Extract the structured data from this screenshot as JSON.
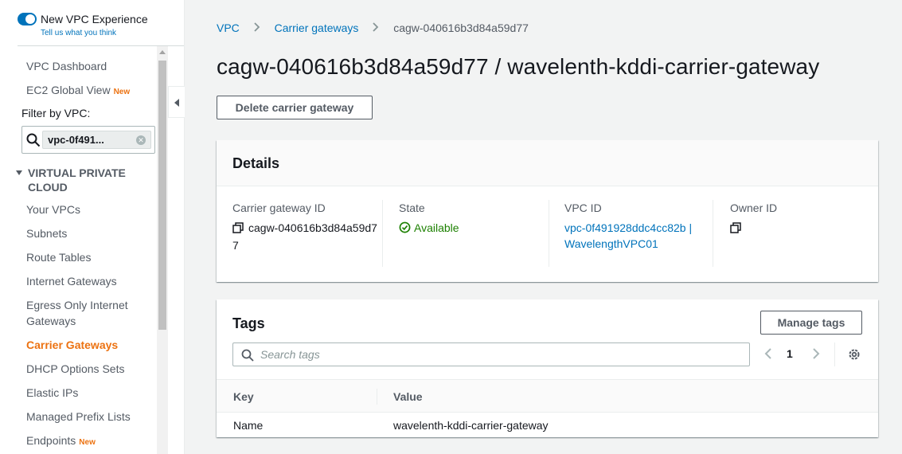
{
  "sidebar": {
    "toggle": {
      "title": "New VPC Experience",
      "subtitle": "Tell us what you think",
      "enabled": true
    },
    "top_items": [
      {
        "label": "VPC Dashboard",
        "badge": ""
      },
      {
        "label": "EC2 Global View",
        "badge": "New"
      }
    ],
    "filter": {
      "label": "Filter by VPC:",
      "value": "vpc-0f491..."
    },
    "section": {
      "title": "VIRTUAL PRIVATE CLOUD"
    },
    "items": [
      {
        "label": "Your VPCs",
        "badge": ""
      },
      {
        "label": "Subnets",
        "badge": ""
      },
      {
        "label": "Route Tables",
        "badge": ""
      },
      {
        "label": "Internet Gateways",
        "badge": ""
      },
      {
        "label": "Egress Only Internet Gateways",
        "badge": ""
      },
      {
        "label": "Carrier Gateways",
        "badge": "",
        "active": true
      },
      {
        "label": "DHCP Options Sets",
        "badge": ""
      },
      {
        "label": "Elastic IPs",
        "badge": ""
      },
      {
        "label": "Managed Prefix Lists",
        "badge": ""
      },
      {
        "label": "Endpoints",
        "badge": "New"
      }
    ]
  },
  "breadcrumb": [
    {
      "label": "VPC"
    },
    {
      "label": "Carrier gateways"
    },
    {
      "label": "cagw-040616b3d84a59d77"
    }
  ],
  "page": {
    "title": "cagw-040616b3d84a59d77 / wavelenth-kddi-carrier-gateway",
    "delete_button": "Delete carrier gateway"
  },
  "details": {
    "title": "Details",
    "fields": {
      "carrier_gateway_id": {
        "label": "Carrier gateway ID",
        "value": "cagw-040616b3d84a59d77"
      },
      "state": {
        "label": "State",
        "value": "Available"
      },
      "vpc_id": {
        "label": "VPC ID",
        "value": "vpc-0f491928ddc4cc82b | WavelengthVPC01"
      },
      "owner_id": {
        "label": "Owner ID",
        "value": ""
      }
    }
  },
  "tags": {
    "title": "Tags",
    "manage_button": "Manage tags",
    "search_placeholder": "Search tags",
    "search_value": "",
    "page_number": "1",
    "columns": [
      "Key",
      "Value"
    ],
    "rows": [
      {
        "key": "Name",
        "value": "wavelenth-kddi-carrier-gateway"
      }
    ]
  },
  "colors": {
    "link": "#0073bb",
    "active_nav": "#ec7211",
    "success": "#1d8102",
    "background": "#f2f3f3"
  },
  "icons": [
    "search-icon",
    "copy-icon",
    "status-available-icon",
    "chevron-left-icon",
    "chevron-right-icon",
    "settings-gear-icon",
    "caret-down-icon",
    "collapse-sidebar-icon"
  ]
}
